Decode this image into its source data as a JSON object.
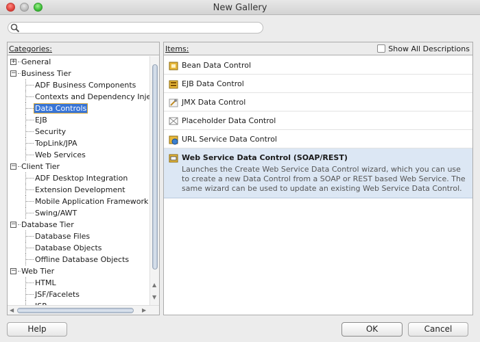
{
  "window": {
    "title": "New Gallery"
  },
  "search": {
    "placeholder": "",
    "value": ""
  },
  "categories": {
    "header": "Categories:",
    "items": [
      {
        "label": "General",
        "level": 0,
        "expander": "+",
        "selected": false
      },
      {
        "label": "Business Tier",
        "level": 0,
        "expander": "−",
        "selected": false
      },
      {
        "label": "ADF Business Components",
        "level": 1,
        "selected": false
      },
      {
        "label": "Contexts and Dependency Injec",
        "level": 1,
        "selected": false
      },
      {
        "label": "Data Controls",
        "level": 1,
        "selected": true
      },
      {
        "label": "EJB",
        "level": 1,
        "selected": false
      },
      {
        "label": "Security",
        "level": 1,
        "selected": false
      },
      {
        "label": "TopLink/JPA",
        "level": 1,
        "selected": false
      },
      {
        "label": "Web Services",
        "level": 1,
        "selected": false
      },
      {
        "label": "Client Tier",
        "level": 0,
        "expander": "−",
        "selected": false
      },
      {
        "label": "ADF Desktop Integration",
        "level": 1,
        "selected": false
      },
      {
        "label": "Extension Development",
        "level": 1,
        "selected": false
      },
      {
        "label": "Mobile Application Framework",
        "level": 1,
        "selected": false
      },
      {
        "label": "Swing/AWT",
        "level": 1,
        "selected": false
      },
      {
        "label": "Database Tier",
        "level": 0,
        "expander": "−",
        "selected": false
      },
      {
        "label": "Database Files",
        "level": 1,
        "selected": false
      },
      {
        "label": "Database Objects",
        "level": 1,
        "selected": false
      },
      {
        "label": "Offline Database Objects",
        "level": 1,
        "selected": false
      },
      {
        "label": "Web Tier",
        "level": 0,
        "expander": "−",
        "selected": false
      },
      {
        "label": "HTML",
        "level": 1,
        "selected": false
      },
      {
        "label": "JSF/Facelets",
        "level": 1,
        "selected": false
      },
      {
        "label": "JSP",
        "level": 1,
        "selected": false
      }
    ]
  },
  "items": {
    "header": "Items:",
    "show_all_label": "Show All Descriptions",
    "show_all_checked": false,
    "list": [
      {
        "label": "Bean Data Control",
        "icon": "bean-data-control-icon"
      },
      {
        "label": "EJB Data Control",
        "icon": "ejb-data-control-icon"
      },
      {
        "label": "JMX Data Control",
        "icon": "jmx-data-control-icon"
      },
      {
        "label": "Placeholder Data Control",
        "icon": "placeholder-data-control-icon"
      },
      {
        "label": "URL Service Data Control",
        "icon": "url-service-data-control-icon"
      },
      {
        "label": "Web Service Data Control (SOAP/REST)",
        "icon": "web-service-data-control-icon",
        "description": "Launches the Create Web Service Data Control wizard, which you can use to create a new Data Control from a SOAP or REST based Web Service. The same wizard can be used to update an existing Web Service Data Control."
      }
    ]
  },
  "buttons": {
    "help": "Help",
    "ok": "OK",
    "cancel": "Cancel"
  },
  "colors": {
    "selection": "#3875d7",
    "selected_item_bg": "#dce7f4"
  }
}
